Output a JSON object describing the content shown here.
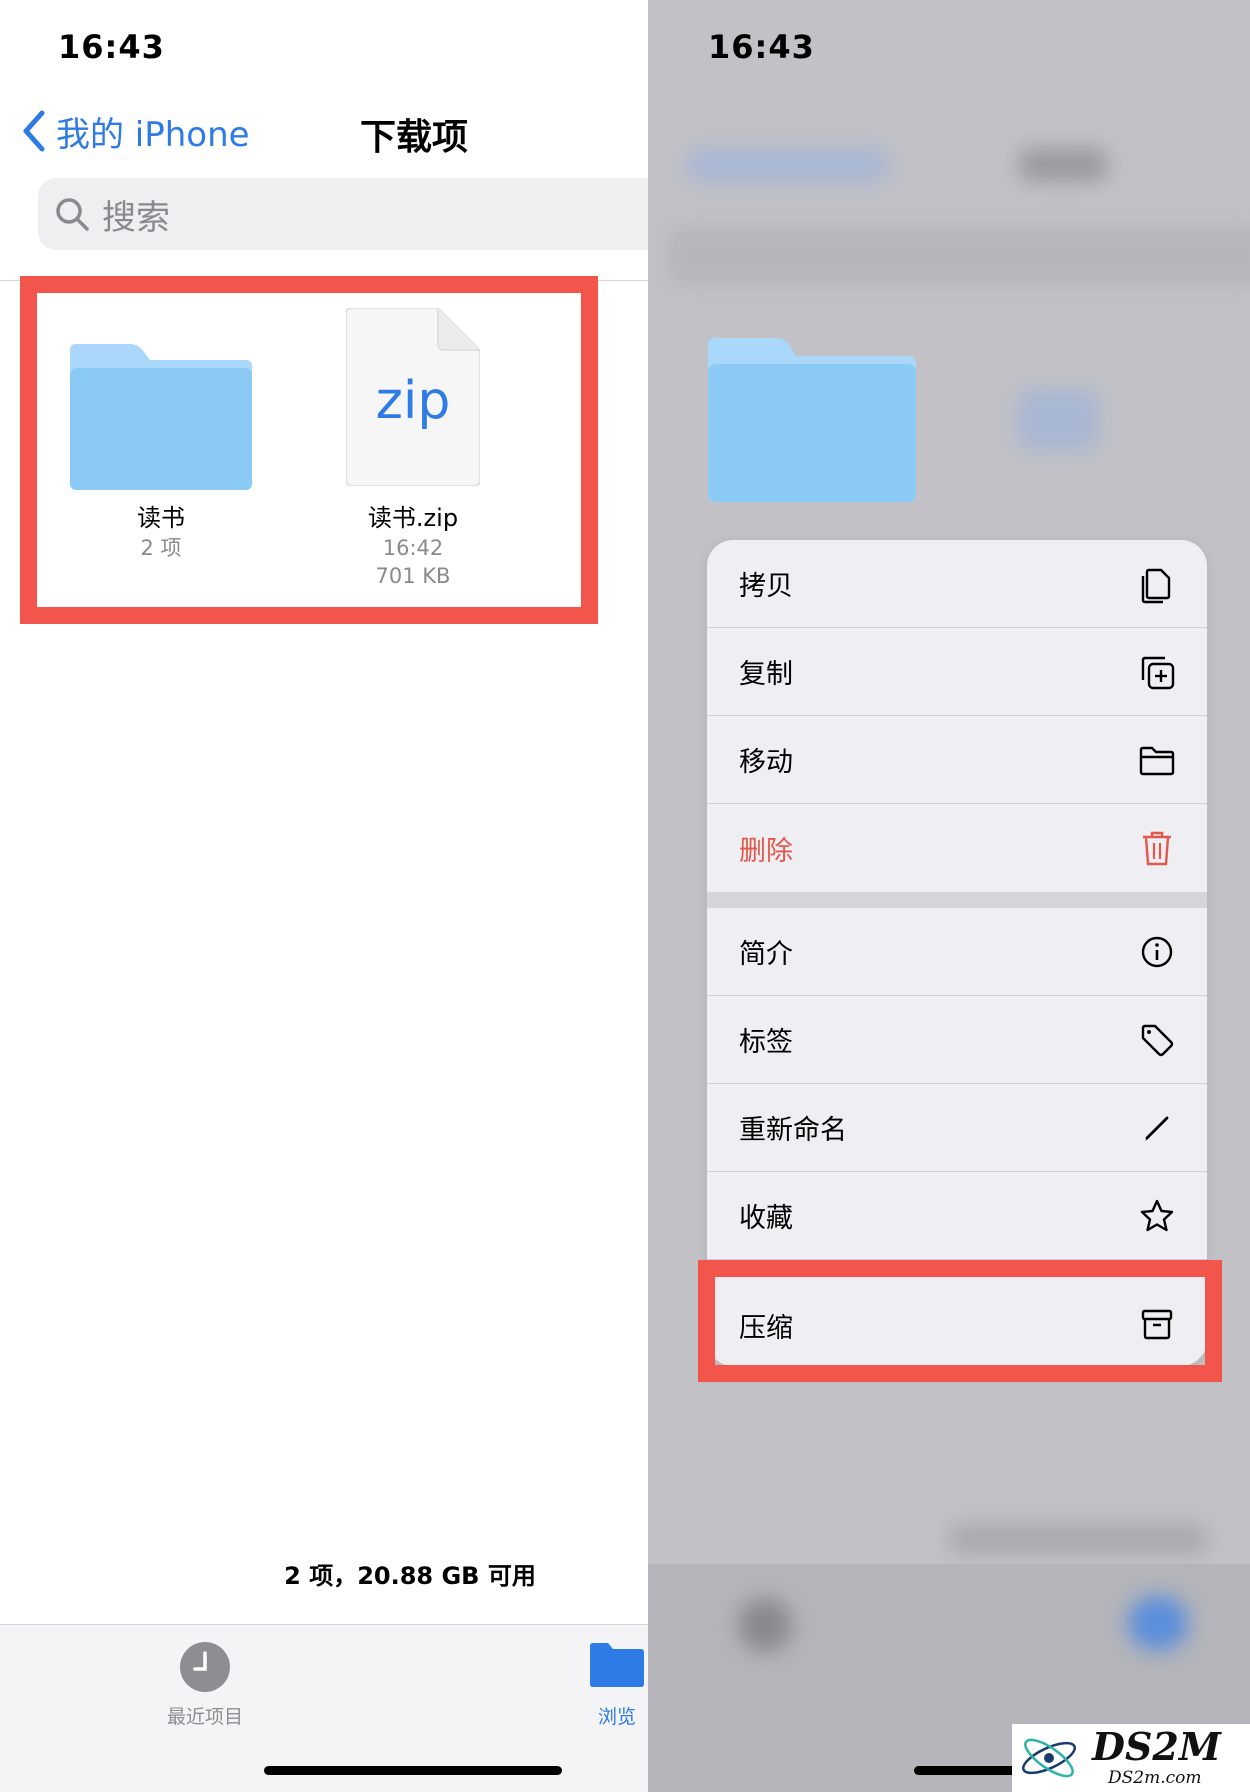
{
  "left": {
    "status_time": "16:43",
    "nav": {
      "back_label": "我的 iPhone",
      "title": "下载项"
    },
    "search": {
      "placeholder": "搜索"
    },
    "files": [
      {
        "name": "读书",
        "meta": [
          "2 项"
        ]
      },
      {
        "name": "读书.zip",
        "meta": [
          "16:42",
          "701 KB"
        ],
        "icon_text": "zip"
      }
    ],
    "footer_info": "2 项，20.88 GB 可用",
    "tabs": [
      {
        "label": "最近项目",
        "icon": "clock-icon"
      },
      {
        "label": "浏览",
        "icon": "folder-icon"
      }
    ]
  },
  "right": {
    "status_time": "16:43",
    "menu_group1": [
      {
        "label": "拷贝",
        "icon": "copy-icon"
      },
      {
        "label": "复制",
        "icon": "duplicate-icon"
      },
      {
        "label": "移动",
        "icon": "folder-icon"
      },
      {
        "label": "删除",
        "icon": "trash-icon",
        "destructive": true
      }
    ],
    "menu_group2": [
      {
        "label": "简介",
        "icon": "info-icon"
      },
      {
        "label": "标签",
        "icon": "tag-icon"
      },
      {
        "label": "重新命名",
        "icon": "pencil-icon"
      },
      {
        "label": "收藏",
        "icon": "star-icon"
      },
      {
        "label": "压缩",
        "icon": "archive-icon"
      }
    ]
  },
  "watermark": {
    "brand": "DS2M",
    "domain": "DS2m.com"
  },
  "colors": {
    "accent": "#2f7be6",
    "highlight": "#f1554b",
    "destructive": "#e3584b",
    "folder": "#8ccaf6"
  }
}
